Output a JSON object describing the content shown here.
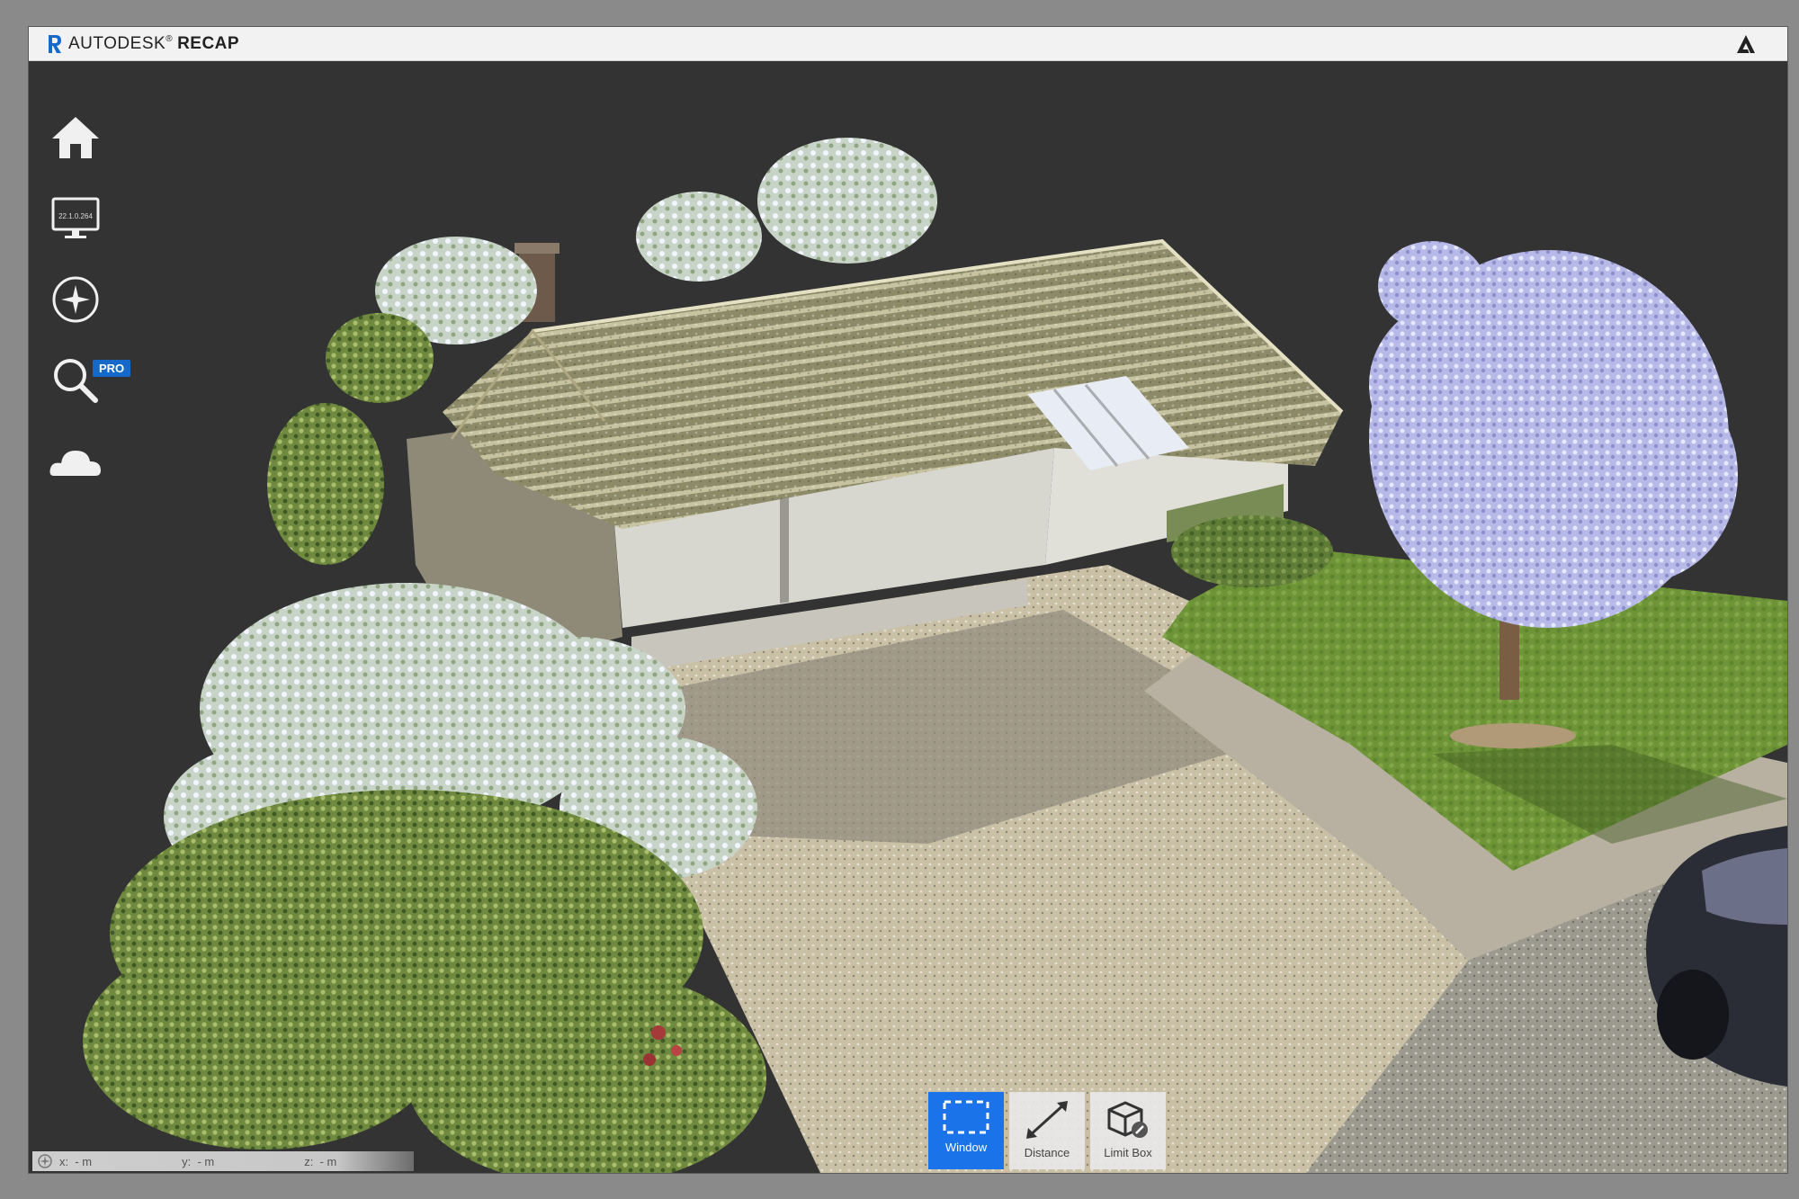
{
  "window": {
    "brand": "AUTODESK",
    "brand_mark": "®",
    "product": "RECAP"
  },
  "sidebar": {
    "items": [
      {
        "name": "home",
        "icon": "home-icon"
      },
      {
        "name": "project",
        "icon": "monitor-icon",
        "version": "22.1.0.264"
      },
      {
        "name": "navigate",
        "icon": "compass-icon"
      },
      {
        "name": "search",
        "icon": "search-icon",
        "badge": "PRO"
      },
      {
        "name": "cloud",
        "icon": "cloud-icon"
      }
    ]
  },
  "tools": [
    {
      "label": "Window",
      "icon": "window-select-icon",
      "active": true
    },
    {
      "label": "Distance",
      "icon": "distance-icon",
      "active": false
    },
    {
      "label": "Limit Box",
      "icon": "limit-box-icon",
      "active": false
    }
  ],
  "coords": {
    "x": "x:  - m",
    "y": "y:  - m",
    "z": "z:  - m"
  },
  "colors": {
    "accent": "#1a73e8",
    "pro_badge": "#1469c9",
    "viewport_bg": "#333333"
  }
}
